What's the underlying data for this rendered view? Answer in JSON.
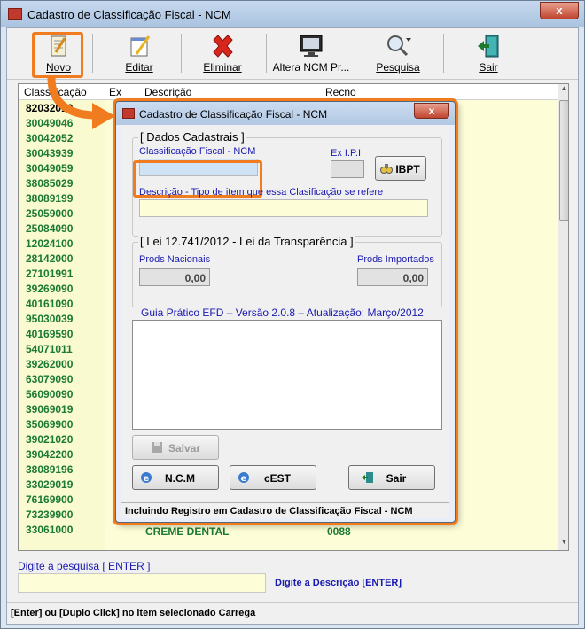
{
  "window": {
    "title": "Cadastro de Classificação Fiscal - NCM",
    "close": "x"
  },
  "toolbar": {
    "novo": "Novo",
    "editar": "Editar",
    "eliminar": "Eliminar",
    "altera": "Altera NCM Pr...",
    "pesquisa": "Pesquisa",
    "sair": "Sair"
  },
  "grid": {
    "headers": [
      "Classificação",
      "Ex",
      "Descrição",
      "Recno"
    ],
    "rows": [
      "82032010",
      "30049046",
      "30042052",
      "30043939",
      "30049059",
      "38085029",
      "38089199",
      "25059000",
      "25084090",
      "12024100",
      "28142000",
      "27101991",
      "39269090",
      "40161090",
      "95030039",
      "40169590",
      "54071011",
      "39262000",
      "63079090",
      "56090090",
      "39069019",
      "35069900",
      "39021020",
      "39042200",
      "38089196",
      "33029019",
      "76169900",
      "73239900",
      "33061000"
    ],
    "last_desc": "CREME DENTAL",
    "last_recno": "0088"
  },
  "search": {
    "label": "Digite a pesquisa [ ENTER ]",
    "hint": "Digite a Descrição [ENTER]",
    "value": ""
  },
  "status": "[Enter] ou [Duplo Click] no item selecionado Carrega",
  "dialog": {
    "title": "Cadastro de Classificação Fiscal - NCM",
    "close": "x",
    "grp1": "[ Dados Cadastrais ]",
    "ncm_label": "Classificação Fiscal - NCM",
    "exipi_label": "Ex I.P.I",
    "ibpt": "IBPT",
    "desc_label": "Descrição - Tipo de item que essa Clasificação se refere",
    "grp2": "[ Lei 12.741/2012 - Lei da Transparência ]",
    "nac_label": "Prods Nacionais",
    "imp_label": "Prods Importados",
    "nac_value": "0,00",
    "imp_value": "0,00",
    "guia": "Guia Prático EFD – Versão 2.0.8 – Atualização: Março/2012",
    "salvar": "Salvar",
    "ncm_btn": "N.C.M",
    "cest_btn": "cEST",
    "sair_btn": "Sair",
    "status": "Incluindo Registro em Cadastro de Classificação Fiscal - NCM"
  },
  "colors": {
    "accent": "#f07c1f",
    "grid_text": "#1a7a33",
    "label_blue": "#1a1ab0",
    "grid_bg": "#fdfdd8"
  }
}
